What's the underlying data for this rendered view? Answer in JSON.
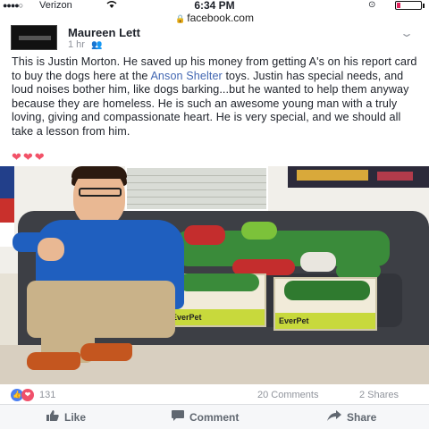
{
  "status_bar": {
    "signal": "●●●●○",
    "carrier": "Verizon",
    "time": "6:34 PM"
  },
  "browser": {
    "url": "facebook.com"
  },
  "post": {
    "author": "Maureen Lett",
    "time_ago": "1 hr",
    "audience_icon": "friends-icon",
    "text_before_link": "This is Justin Morton. He saved up his money from getting A's on his report card to buy the dogs here at the ",
    "link_text": "Anson Shelter",
    "text_after_link": " toys. Justin has special needs, and loud noises bother him, like dogs barking...but he wanted to help them anyway because they are homeless. He is such an awesome young man with a truly loving, giving and compassionate heart. He is very special, and we should all take a lesson from him.",
    "hearts": "❤❤❤",
    "photo_box_label_1": "EverPet",
    "photo_box_label_2": "EverPet"
  },
  "reactions": {
    "count": "131",
    "comments": "20 Comments",
    "shares": "2 Shares"
  },
  "actions": {
    "like": "Like",
    "comment": "Comment",
    "share": "Share"
  },
  "colors": {
    "link": "#4267b2",
    "like_reaction": "#4a7ff1",
    "love_reaction": "#f0506b"
  }
}
